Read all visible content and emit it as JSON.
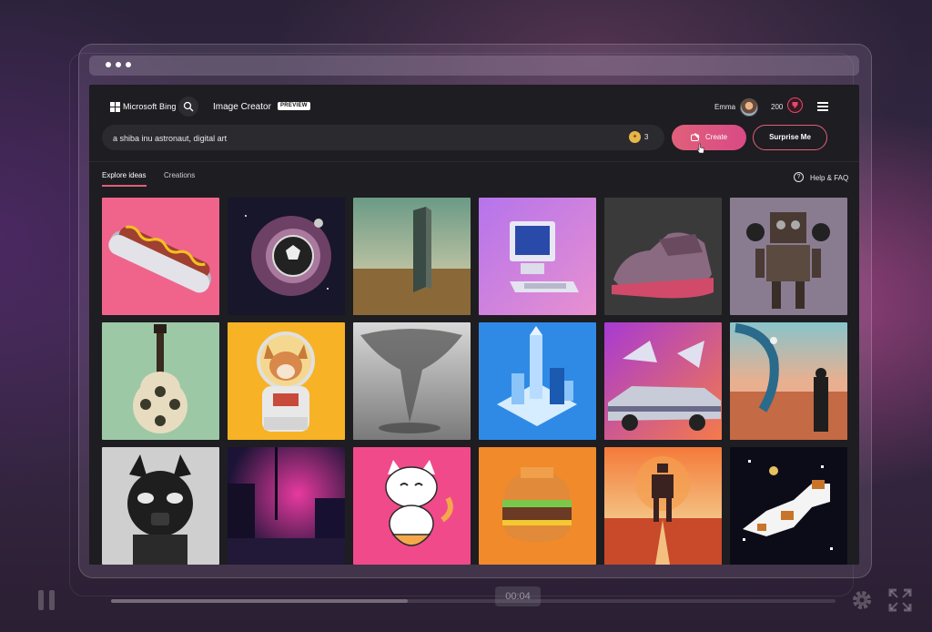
{
  "header": {
    "brand": "Microsoft Bing",
    "title": "Image Creator",
    "badge": "PREVIEW",
    "user_name": "Emma",
    "points": "200"
  },
  "prompt": {
    "value": "a shiba inu astronaut, digital art",
    "boost_count": "3",
    "create_label": "Create",
    "surprise_label": "Surprise Me"
  },
  "tabs": [
    {
      "label": "Explore ideas",
      "active": true
    },
    {
      "label": "Creations",
      "active": false
    }
  ],
  "help_label": "Help & FAQ",
  "gallery": [
    {
      "subject": "hot dog",
      "bg": "#f0648c"
    },
    {
      "subject": "exploding soccer ball in space",
      "bg": "#1c1a2a"
    },
    {
      "subject": "monolith in desert",
      "bg": "#7aa08a"
    },
    {
      "subject": "retro computer",
      "bg": "#b77ee6"
    },
    {
      "subject": "sneaker",
      "bg": "#3a3a3a"
    },
    {
      "subject": "steampunk robot",
      "bg": "#8a7c90"
    },
    {
      "subject": "sushi guitar",
      "bg": "#9cc8a6"
    },
    {
      "subject": "shiba inu astronaut",
      "bg": "#f7b325"
    },
    {
      "subject": "tornado sculpture",
      "bg": "#9a9a9a"
    },
    {
      "subject": "isometric city",
      "bg": "#2f8ae6"
    },
    {
      "subject": "delorean car",
      "bg": "#d24a9c"
    },
    {
      "subject": "surreal desert figure",
      "bg": "#d87856"
    },
    {
      "subject": "black masked figurine",
      "bg": "#c8c8c8"
    },
    {
      "subject": "neon alley",
      "bg": "#2c1c4a"
    },
    {
      "subject": "lucky cat eating noodles",
      "bg": "#f04a8a"
    },
    {
      "subject": "burger",
      "bg": "#f08a2a"
    },
    {
      "subject": "robot at sunset",
      "bg": "#e86a3a"
    },
    {
      "subject": "pixel dog in space",
      "bg": "#0c0c18"
    }
  ],
  "video": {
    "time": "00:04",
    "progress": 0.41
  },
  "colors": {
    "accent": "#e0607a",
    "app_bg": "#1e1d21",
    "input_bg": "#2b2a2f"
  }
}
